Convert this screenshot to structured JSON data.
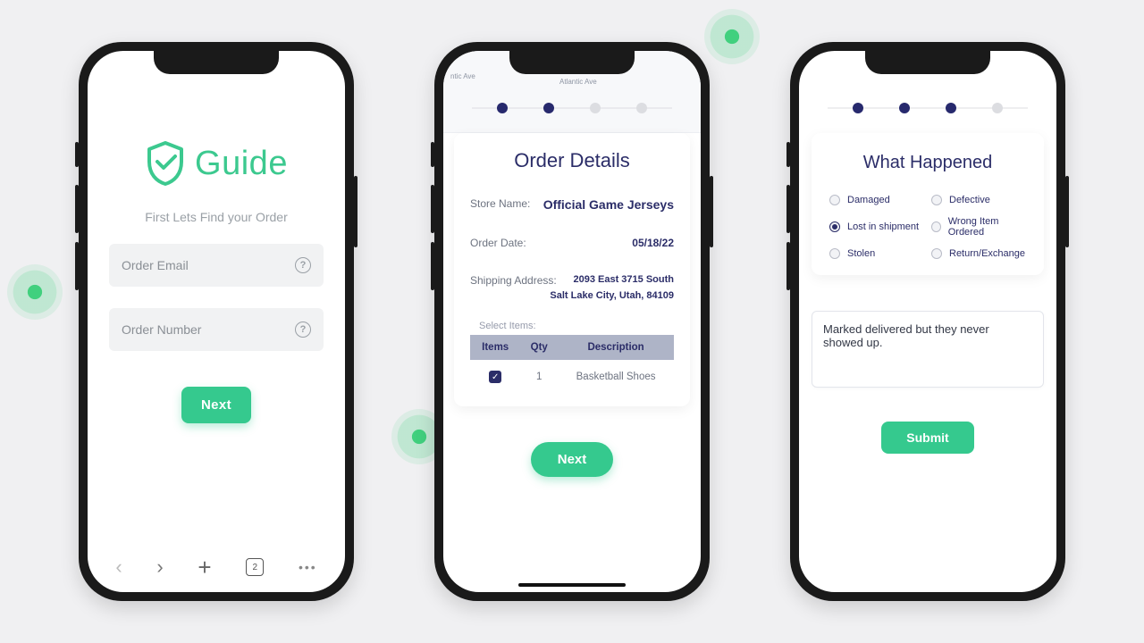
{
  "colors": {
    "accent": "#35c98e",
    "navy": "#2b2d68"
  },
  "screen1": {
    "brand": "Guide",
    "subtitle": "First Lets Find your Order",
    "email_placeholder": "Order Email",
    "number_placeholder": "Order Number",
    "next_label": "Next",
    "browser": {
      "tabs": "2"
    }
  },
  "screen2": {
    "map_labels": [
      "ntic Ave",
      "Atlantic Ave"
    ],
    "title": "Order Details",
    "store_label": "Store Name:",
    "store_value": "Official Game Jerseys",
    "date_label": "Order Date:",
    "date_value": "05/18/22",
    "addr_label": "Shipping Address:",
    "addr_line1": "2093 East 3715 South",
    "addr_line2": "Salt Lake City, Utah, 84109",
    "select_items_label": "Select Items:",
    "table": {
      "headers": [
        "Items",
        "Qty",
        "Description"
      ],
      "rows": [
        {
          "checked": true,
          "qty": "1",
          "desc": "Basketball Shoes"
        }
      ]
    },
    "next_label": "Next"
  },
  "screen3": {
    "title": "What Happened",
    "options": [
      {
        "label": "Damaged",
        "selected": false
      },
      {
        "label": "Defective",
        "selected": false
      },
      {
        "label": "Lost in shipment",
        "selected": true
      },
      {
        "label": "Wrong Item Ordered",
        "selected": false
      },
      {
        "label": "Stolen",
        "selected": false
      },
      {
        "label": "Return/Exchange",
        "selected": false
      }
    ],
    "note": "Marked delivered but they never showed up.",
    "submit_label": "Submit"
  }
}
